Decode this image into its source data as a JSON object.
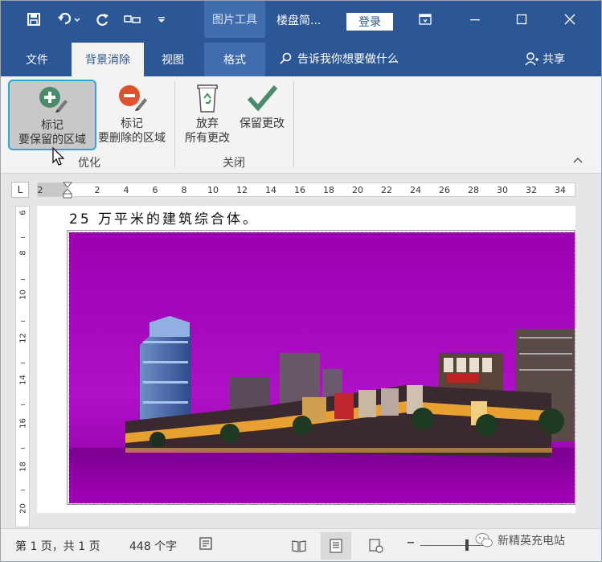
{
  "title_bar": {
    "context_group": "图片工具",
    "doc_title": "楼盘简...",
    "login_label": "登录"
  },
  "tabs": [
    {
      "label": "文件"
    },
    {
      "label": "背景消除"
    },
    {
      "label": "视图"
    },
    {
      "label": "格式"
    }
  ],
  "tell_me": "告诉我你想要做什么",
  "share_label": "共享",
  "ribbon": {
    "mark_keep_line1": "标记",
    "mark_keep_line2": "要保留的区域",
    "mark_remove_line1": "标记",
    "mark_remove_line2": "要删除的区域",
    "discard_line1": "放弃",
    "discard_line2": "所有更改",
    "keep_changes": "保留更改",
    "group_refine": "优化",
    "group_close": "关闭"
  },
  "ruler": {
    "corner": "L",
    "ticks": [
      "2",
      "2",
      "4",
      "6",
      "8",
      "10",
      "12",
      "14",
      "16",
      "18",
      "20",
      "22",
      "24",
      "26",
      "28",
      "30",
      "32",
      "34"
    ],
    "vticks": [
      "6",
      "8",
      "10",
      "12",
      "14",
      "16",
      "18",
      "20"
    ]
  },
  "document": {
    "text": "25 万平米的建筑综合体。"
  },
  "status": {
    "page": "第 1 页，共 1 页",
    "words": "448 个字"
  },
  "watermark": "新精英充电站",
  "colors": {
    "title_bar": "#2b5797",
    "selection_border": "#2ea3e0",
    "image_tint": "#a000b4"
  }
}
